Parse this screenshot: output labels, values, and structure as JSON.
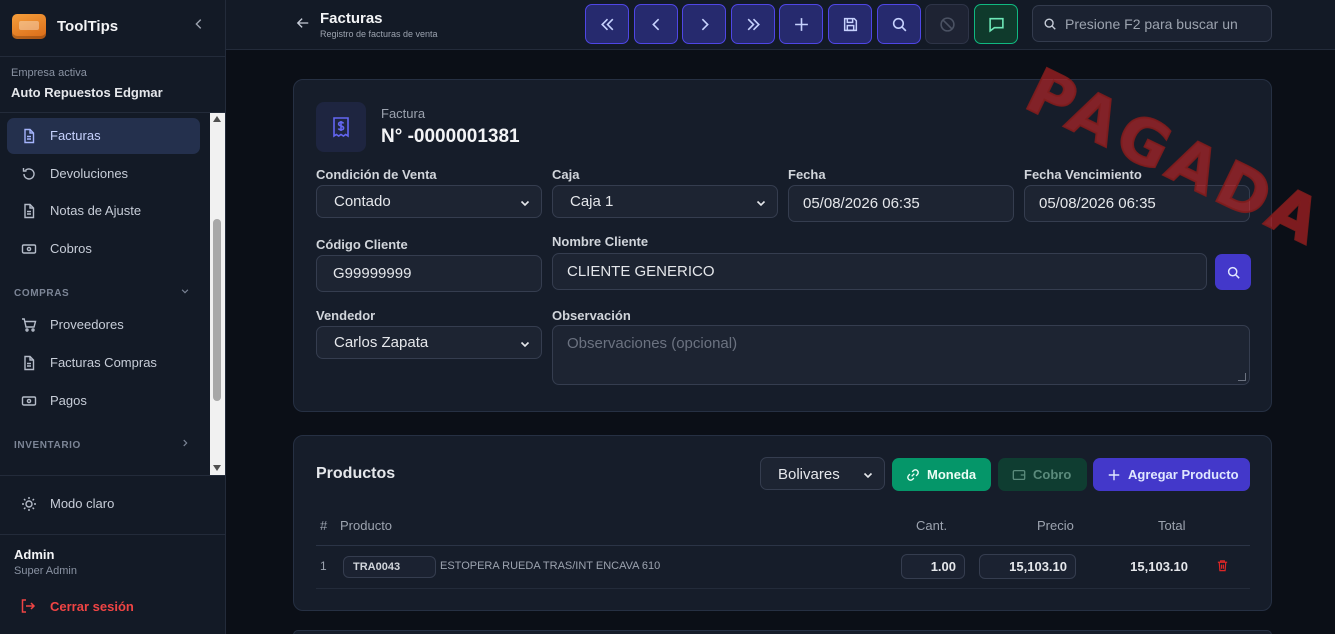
{
  "sidebar": {
    "brand": "ToolTips",
    "company_label": "Empresa activa",
    "company_name": "Auto Repuestos Edgmar",
    "items": [
      {
        "label": "Facturas",
        "icon": "document-icon",
        "active": true
      },
      {
        "label": "Devoluciones",
        "icon": "undo-icon"
      },
      {
        "label": "Notas de Ajuste",
        "icon": "file-text-icon"
      },
      {
        "label": "Cobros",
        "icon": "cash-icon"
      }
    ],
    "section_compras": "COMPRAS",
    "compras_items": [
      {
        "label": "Proveedores",
        "icon": "cart-icon"
      },
      {
        "label": "Facturas Compras",
        "icon": "file-text-icon"
      },
      {
        "label": "Pagos",
        "icon": "cash-icon"
      }
    ],
    "section_inventario": "INVENTARIO",
    "theme_toggle": "Modo claro",
    "user_name": "Admin",
    "user_role": "Super Admin",
    "logout": "Cerrar sesión"
  },
  "header": {
    "title": "Facturas",
    "subtitle": "Registro de facturas de venta",
    "search_placeholder": "Presione F2 para buscar un"
  },
  "invoice": {
    "label": "Factura",
    "number": "N° -0000001381",
    "stamp": "PAGADA",
    "fields": {
      "condicion_label": "Condición de Venta",
      "condicion_value": "Contado",
      "caja_label": "Caja",
      "caja_value": "Caja 1",
      "fecha_label": "Fecha",
      "fecha_value": "05/08/2026 06:35",
      "vencimiento_label": "Fecha Vencimiento",
      "vencimiento_value": "05/08/2026 06:35",
      "codigo_label": "Código Cliente",
      "codigo_value": "G99999999",
      "nombre_label": "Nombre Cliente",
      "nombre_value": "CLIENTE GENERICO",
      "vendedor_label": "Vendedor",
      "vendedor_value": "Carlos Zapata",
      "observacion_label": "Observación",
      "observacion_placeholder": "Observaciones (opcional)"
    }
  },
  "products": {
    "title": "Productos",
    "currency": "Bolivares",
    "btn_moneda": "Moneda",
    "btn_cobro": "Cobro",
    "btn_agregar": "Agregar Producto",
    "columns": {
      "num": "#",
      "product": "Producto",
      "qty": "Cant.",
      "price": "Precio",
      "total": "Total"
    },
    "rows": [
      {
        "num": "1",
        "code": "TRA0043",
        "description": "ESTOPERA RUEDA TRAS/INT ENCAVA 610",
        "qty": "1.00",
        "price": "15,103.10",
        "total": "15,103.10"
      }
    ]
  },
  "colors": {
    "accent": "#4f46e5",
    "success": "#059669",
    "danger": "#dc2626",
    "background": "#0b0f17",
    "card": "#161d2a"
  }
}
